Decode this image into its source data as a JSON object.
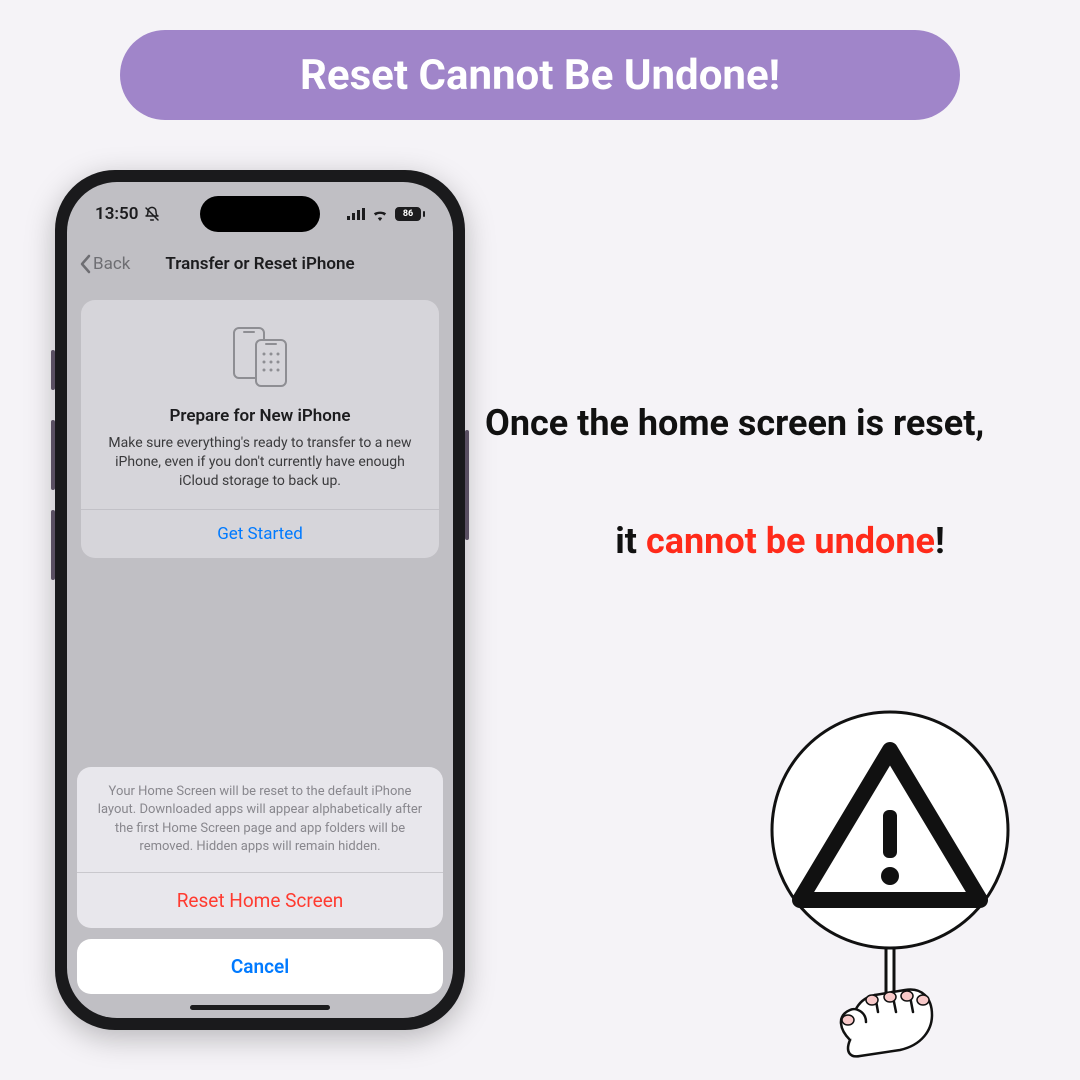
{
  "banner": {
    "text": "Reset Cannot Be Undone!"
  },
  "phone": {
    "status": {
      "time": "13:50",
      "battery": "86"
    },
    "nav": {
      "back": "Back",
      "title": "Transfer or Reset iPhone"
    },
    "card": {
      "title": "Prepare for New iPhone",
      "body": "Make sure everything's ready to transfer to a new iPhone, even if you don't currently have enough iCloud storage to back up.",
      "link": "Get Started"
    },
    "sheet": {
      "message": "Your Home Screen will be reset to the default iPhone layout. Downloaded apps will appear alphabetically after the first Home Screen page and app folders will be removed. Hidden apps will remain hidden.",
      "action": "Reset Home Screen",
      "cancel": "Cancel"
    }
  },
  "caption": {
    "line1": "Once the home screen is reset,",
    "line2_prefix": "it ",
    "line2_emph": "cannot be undone",
    "line2_suffix": "!"
  }
}
